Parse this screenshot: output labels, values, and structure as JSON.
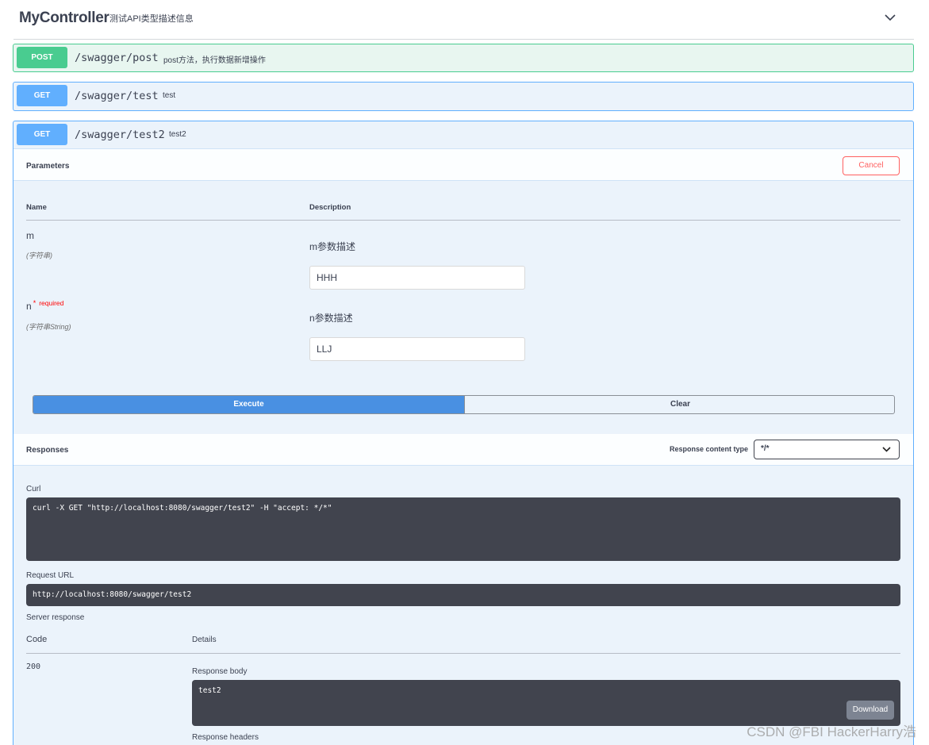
{
  "tag": {
    "title": "MyController",
    "description": "测试API类型描述信息"
  },
  "operations": [
    {
      "method": "POST",
      "path": "/swagger/post",
      "summary": "post方法，执行数据新增操作"
    },
    {
      "method": "GET",
      "path": "/swagger/test",
      "summary": "test"
    },
    {
      "method": "GET",
      "path": "/swagger/test2",
      "summary": "test2"
    }
  ],
  "parameters": {
    "title": "Parameters",
    "cancel_label": "Cancel",
    "col_name": "Name",
    "col_description": "Description",
    "items": [
      {
        "name": "m",
        "type": "(字符串)",
        "required": false,
        "description": "m参数描述",
        "value": "HHH"
      },
      {
        "name": "n",
        "type": "(字符串String)",
        "required": true,
        "required_label": "required",
        "required_star": "*",
        "description": "n参数描述",
        "value": "LLJ"
      }
    ],
    "execute_label": "Execute",
    "clear_label": "Clear"
  },
  "responses": {
    "title": "Responses",
    "content_type_label": "Response content type",
    "content_type_value": "*/*",
    "curl_label": "Curl",
    "curl_command": "curl -X GET \"http://localhost:8080/swagger/test2\" -H \"accept: */*\"",
    "request_url_label": "Request URL",
    "request_url": "http://localhost:8080/swagger/test2",
    "server_response_label": "Server response",
    "col_code": "Code",
    "col_details": "Details",
    "code": "200",
    "response_body_label": "Response body",
    "response_body": "test2",
    "download_label": "Download",
    "response_headers_label": "Response headers"
  },
  "watermark": "CSDN @FBI HackerHarry浩",
  "colors": {
    "post": "#49cc90",
    "get": "#61affe",
    "execute": "#4990e2",
    "cancel": "#ff6060",
    "code_bg": "#41444e"
  }
}
